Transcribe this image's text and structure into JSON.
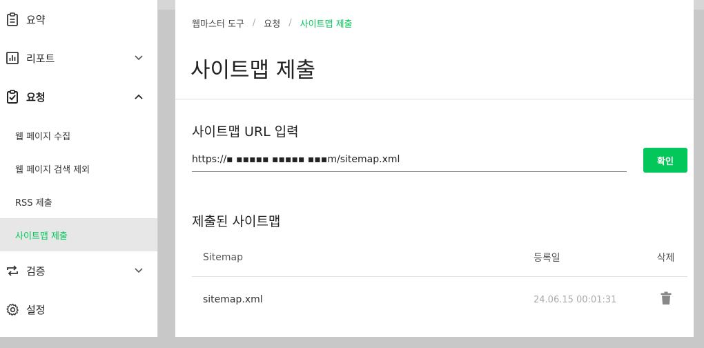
{
  "sidebar": {
    "items": [
      {
        "label": "요약",
        "icon": "clipboard-icon"
      },
      {
        "label": "리포트",
        "icon": "bar-chart-icon"
      },
      {
        "label": "요청",
        "icon": "clipboard-check-icon"
      },
      {
        "label": "검증",
        "icon": "repeat-icon"
      },
      {
        "label": "설정",
        "icon": "gear-icon"
      }
    ],
    "sub_items": [
      {
        "label": "웹 페이지 수집"
      },
      {
        "label": "웹 페이지 검색 제외"
      },
      {
        "label": "RSS 제출"
      },
      {
        "label": "사이트맵 제출"
      }
    ]
  },
  "breadcrumb": {
    "items": [
      "웹마스터 도구",
      "요청",
      "사이트맵 제출"
    ],
    "separator": "/"
  },
  "page": {
    "title": "사이트맵 제출"
  },
  "url_section": {
    "title": "사이트맵 URL 입력",
    "input_value": "https://▪ ▪▪▪▪▪ ▪▪▪▪▪ ▪▪▪m/sitemap.xml",
    "confirm_label": "확인"
  },
  "submitted_section": {
    "title": "제출된 사이트맵",
    "columns": [
      "Sitemap",
      "등록일",
      "삭제"
    ],
    "rows": [
      {
        "sitemap": "sitemap.xml",
        "date": "24.06.15 00:01:31"
      }
    ]
  },
  "colors": {
    "accent": "#03c75a",
    "active_bg": "#e7e7e7"
  }
}
